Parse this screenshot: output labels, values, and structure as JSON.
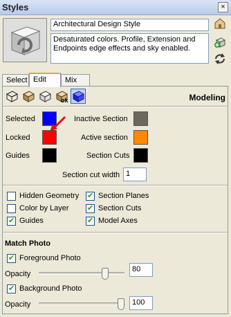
{
  "window": {
    "title": "Styles",
    "close_glyph": "×"
  },
  "style": {
    "name": "Architectural Design Style",
    "description": "Desaturated colors. Profile, Extension and Endpoints edge effects and sky enabled."
  },
  "tabs": [
    {
      "label": "Select"
    },
    {
      "label": "Edit"
    },
    {
      "label": "Mix"
    }
  ],
  "active_tab": "Edit",
  "edit_category": "Modeling",
  "colors": {
    "selected": "#0000ff",
    "locked": "#ff0000",
    "guides": "#000000",
    "inactive_section": "#6d675e",
    "active_section": "#ff8800",
    "section_cuts": "#000000"
  },
  "labels": {
    "selected": "Selected",
    "locked": "Locked",
    "guides": "Guides",
    "inactive_section": "Inactive Section",
    "active_section": "Active section",
    "section_cuts": "Section Cuts",
    "section_cut_width": "Section cut width"
  },
  "section_cut_width": "1",
  "checkboxes": {
    "hidden_geometry": {
      "label": "Hidden Geometry",
      "checked": false
    },
    "color_by_layer": {
      "label": "Color by Layer",
      "checked": false
    },
    "guides": {
      "label": "Guides",
      "checked": true
    },
    "section_planes": {
      "label": "Section Planes",
      "checked": true
    },
    "section_cuts": {
      "label": "Section Cuts",
      "checked": true
    },
    "model_axes": {
      "label": "Model Axes",
      "checked": true
    }
  },
  "match_photo": {
    "heading": "Match Photo",
    "foreground": {
      "label": "Foreground Photo",
      "checked": true,
      "opacity_label": "Opacity",
      "opacity": "80",
      "slider_fraction": 0.8
    },
    "background": {
      "label": "Background Photo",
      "checked": true,
      "opacity_label": "Opacity",
      "opacity": "100",
      "slider_fraction": 1.0
    }
  }
}
